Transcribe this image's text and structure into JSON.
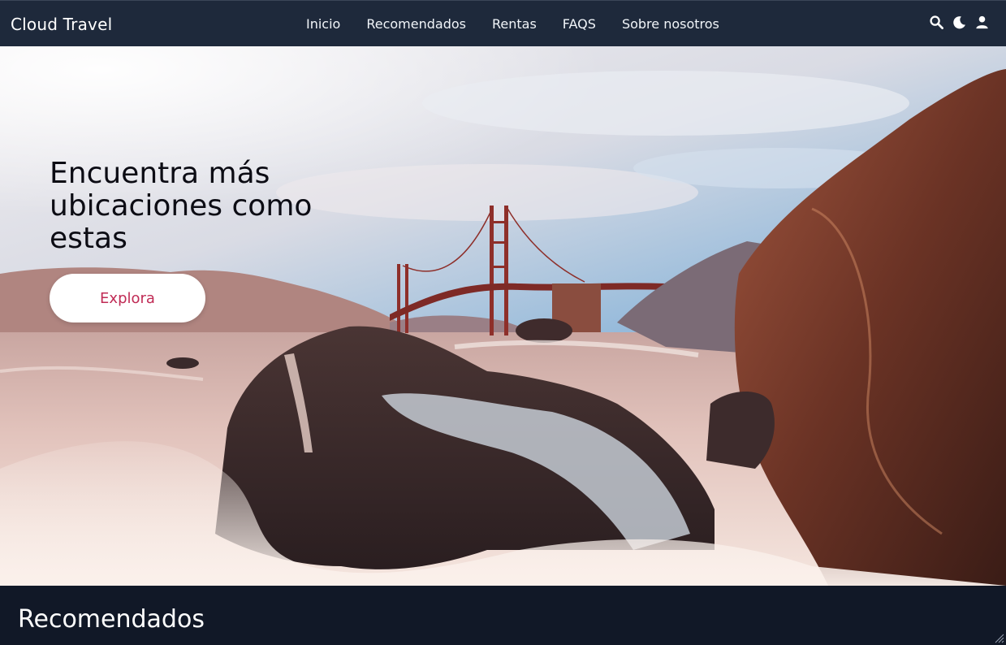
{
  "navbar": {
    "brand": "Cloud Travel",
    "links": [
      "Inicio",
      "Recomendados",
      "Rentas",
      "FAQS",
      "Sobre nosotros"
    ],
    "icons": [
      "search-icon",
      "moon-icon",
      "user-icon"
    ]
  },
  "hero": {
    "title": "Encuentra más ubicaciones como estas",
    "button_label": "Explora",
    "accent_color": "#c02b55"
  },
  "section": {
    "title": "Recomendados"
  },
  "colors": {
    "navbar_bg": "#1e293b",
    "page_bg": "#111827"
  }
}
